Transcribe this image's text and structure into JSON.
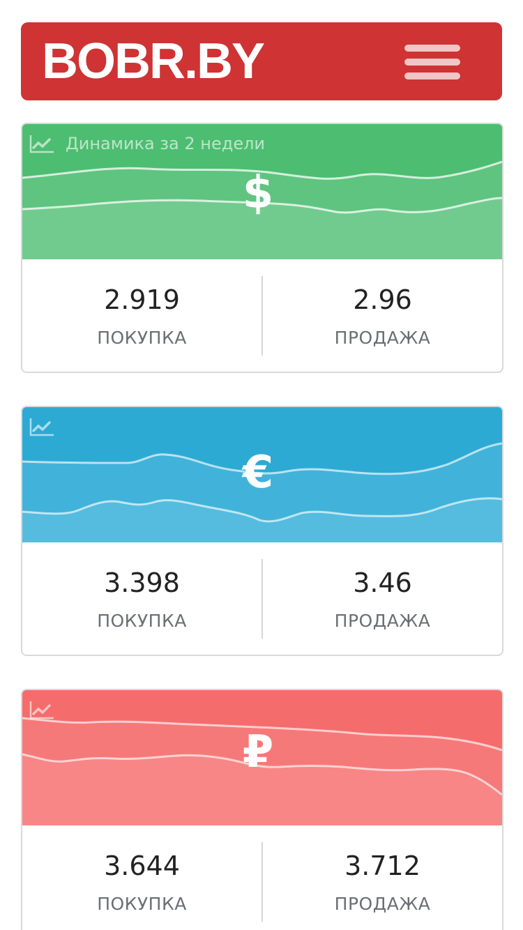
{
  "header": {
    "logo": "BOBR.BY",
    "menu_icon": "hamburger-menu-icon",
    "color": "#cf3333"
  },
  "trend_icon": "trend-chart-icon",
  "cards": [
    {
      "currency": "usd",
      "dynamics_label": "Динамика за 2 недели",
      "symbol": "$",
      "buy": {
        "value": "2.919",
        "label": "ПОКУПКА"
      },
      "sell": {
        "value": "2.96",
        "label": "ПРОДАЖА"
      },
      "colors": {
        "top": "#4dbd71",
        "mid": "#5fc47f",
        "bottom": "#72cb8e"
      }
    },
    {
      "currency": "eur",
      "dynamics_label": "",
      "symbol": "€",
      "buy": {
        "value": "3.398",
        "label": "ПОКУПКА"
      },
      "sell": {
        "value": "3.46",
        "label": "ПРОДАЖА"
      },
      "colors": {
        "top": "#2daad4",
        "mid": "#41b3da",
        "bottom": "#55bcdf"
      }
    },
    {
      "currency": "rub",
      "dynamics_label": "",
      "symbol": "₽",
      "buy": {
        "value": "3.644",
        "label": "ПОКУПКА"
      },
      "sell": {
        "value": "3.712",
        "label": "ПРОДАЖА"
      },
      "colors": {
        "top": "#f56c6c",
        "mid": "#f67979",
        "bottom": "#f88686"
      }
    }
  ]
}
